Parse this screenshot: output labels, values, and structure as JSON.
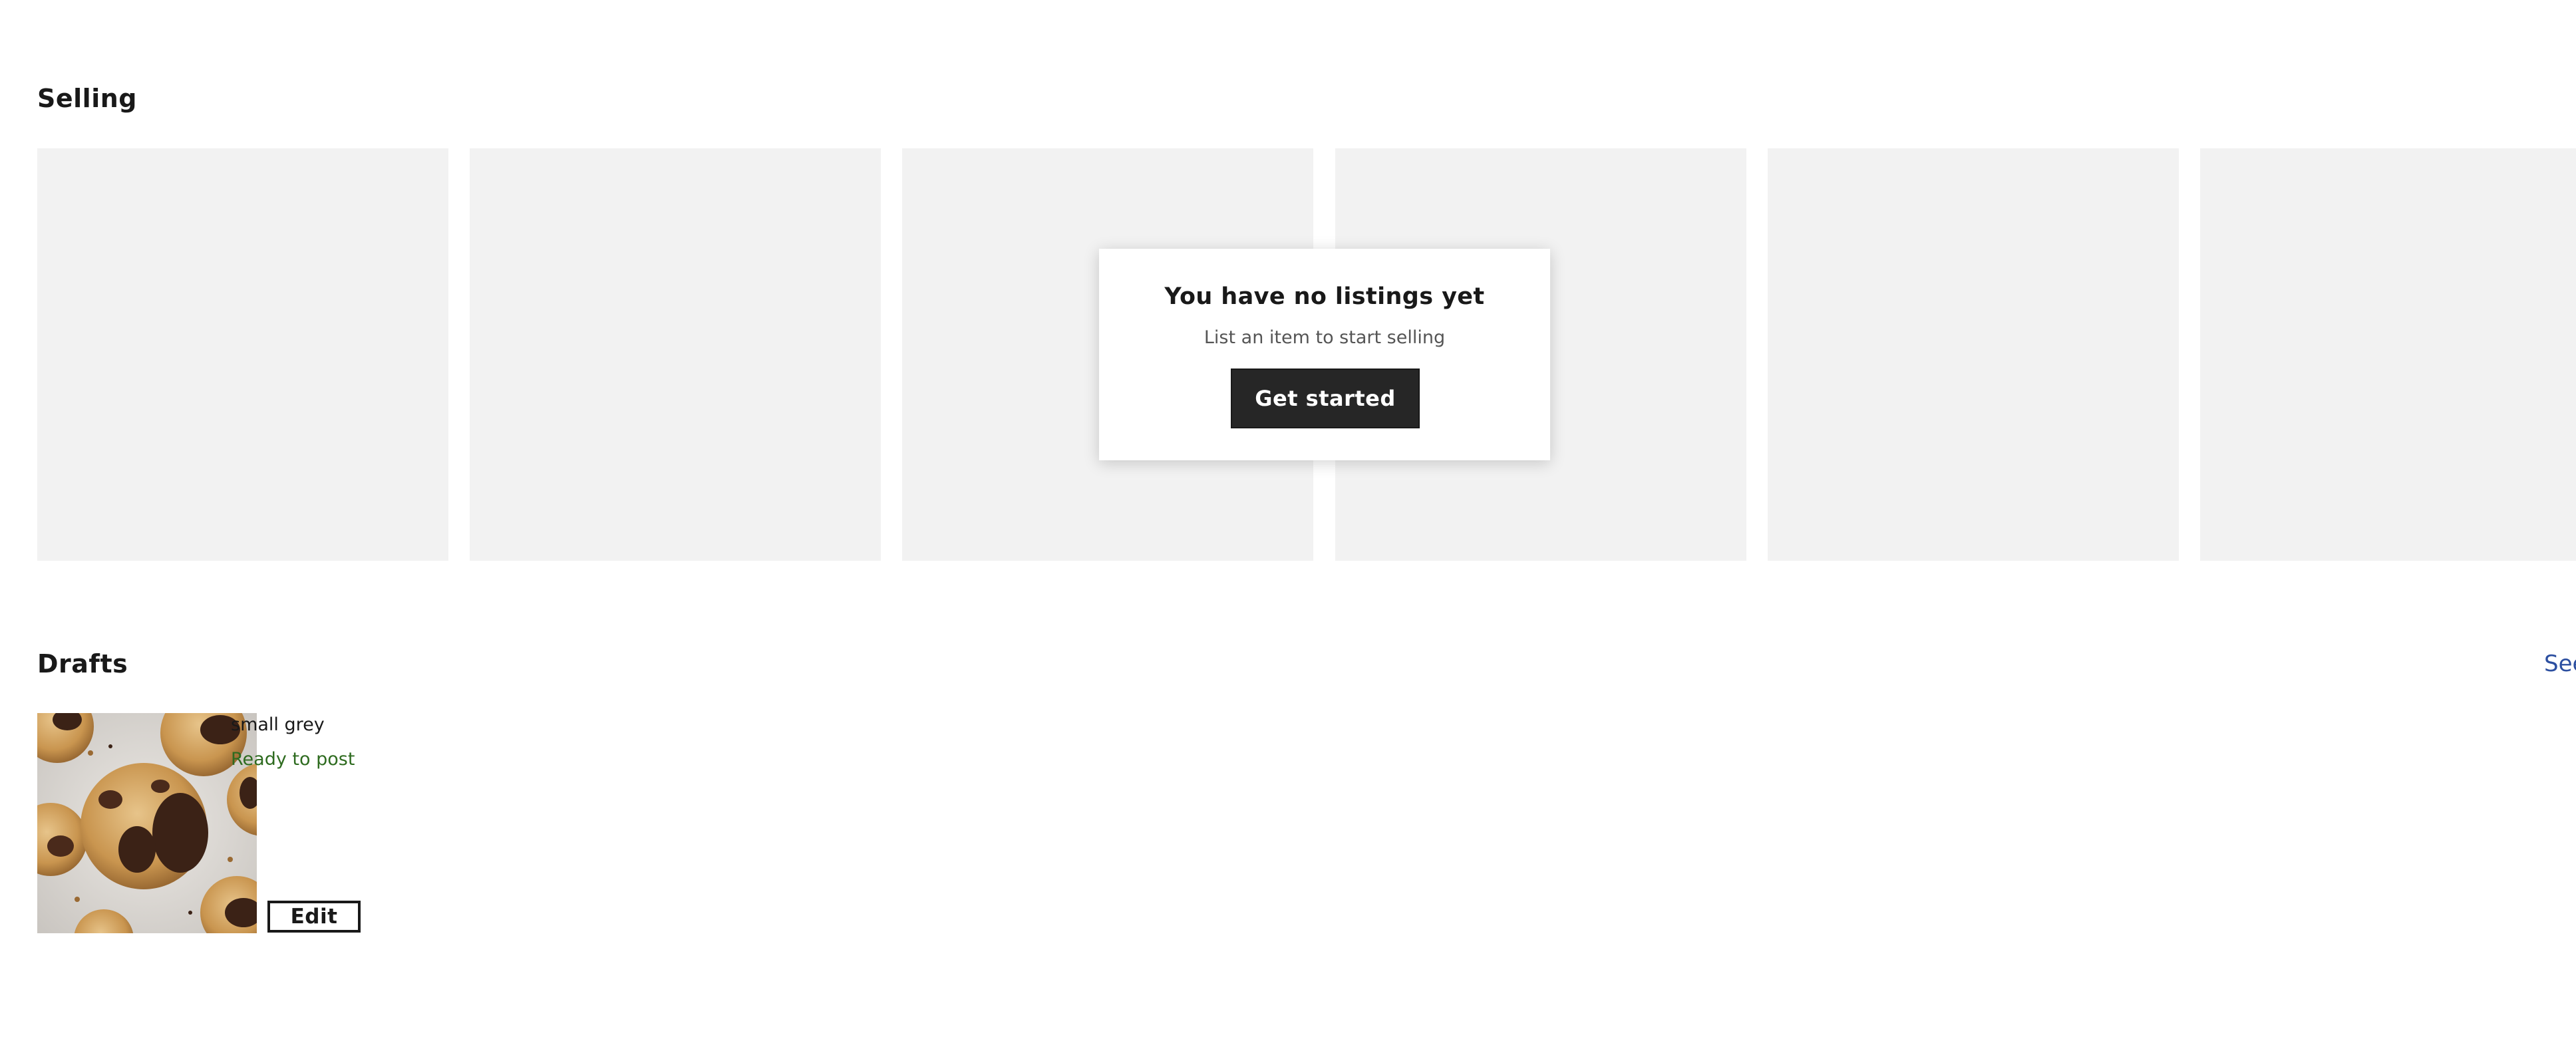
{
  "selling": {
    "title": "Selling",
    "placeholder_cards": 6
  },
  "empty_state": {
    "title": "You have no listings yet",
    "subtitle": "List an item to start selling",
    "button_label": "Get started"
  },
  "drafts": {
    "title": "Drafts",
    "see_all_label": "See",
    "items": [
      {
        "name": "small grey",
        "status": "Ready to post",
        "edit_label": "Edit",
        "image": "cookies-photo"
      }
    ]
  },
  "colors": {
    "placeholder": "#f2f2f2",
    "button_dark": "#262626",
    "status_green": "#2e6b1f",
    "link_blue": "#2c4fa0"
  }
}
